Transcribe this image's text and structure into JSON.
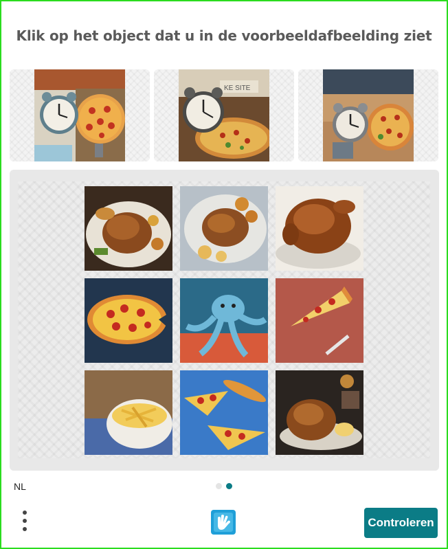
{
  "title": "Klik op het object dat u in de voorbeeldafbeelding ziet",
  "language": "NL",
  "submit_label": "Controleren",
  "colors": {
    "accent": "#0b7c86",
    "border": "#2bdc1e",
    "dot_active": "#0b7c86",
    "dot_inactive": "#e4e4e4"
  },
  "examples": [
    {
      "name": "example-image-clock-pizza-1",
      "depicts": "alarm clock and pizza"
    },
    {
      "name": "example-image-clock-pizza-2",
      "depicts": "alarm clock and pizza"
    },
    {
      "name": "example-image-clock-pizza-3",
      "depicts": "alarm clock and pizza"
    }
  ],
  "tiles": [
    {
      "name": "tile-roast-chicken-1",
      "depicts": "roast chicken"
    },
    {
      "name": "tile-roast-chicken-2",
      "depicts": "roast chicken"
    },
    {
      "name": "tile-roast-chicken-3",
      "depicts": "roast chicken"
    },
    {
      "name": "tile-pizza",
      "depicts": "pizza"
    },
    {
      "name": "tile-octopus",
      "depicts": "octopus"
    },
    {
      "name": "tile-pizza-slice",
      "depicts": "pizza slice"
    },
    {
      "name": "tile-fries",
      "depicts": "fries"
    },
    {
      "name": "tile-pizza-slices",
      "depicts": "pizza slices"
    },
    {
      "name": "tile-roast-chicken-4",
      "depicts": "roast chicken"
    }
  ],
  "pagination": {
    "total": 2,
    "active": 2
  },
  "icons": {
    "menu": "more-vertical-icon",
    "logo": "hand-logo-icon"
  }
}
